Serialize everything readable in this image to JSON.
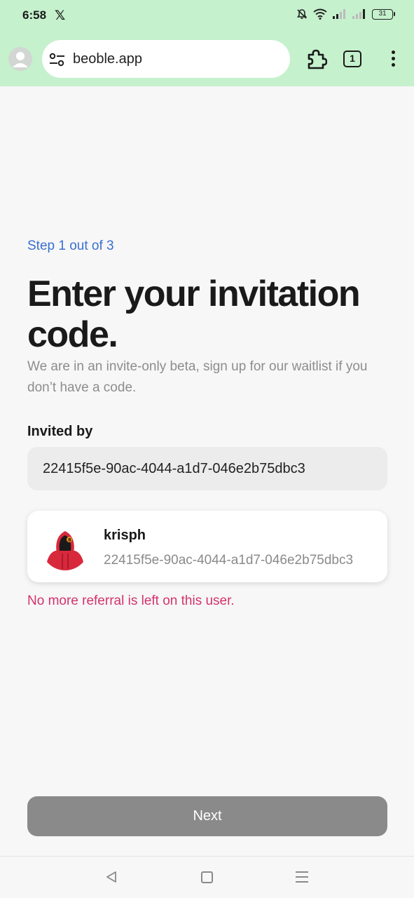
{
  "status_bar": {
    "time": "6:58",
    "battery": "31"
  },
  "browser": {
    "url": "beoble.app",
    "tab_count": "1"
  },
  "page": {
    "step": "Step 1 out of 3",
    "title": "Enter your invitation code.",
    "subtitle": "We are in an invite-only beta, sign up for our waitlist if you don’t have a code.",
    "invited_label": "Invited by",
    "code_value": "22415f5e-90ac-4044-a1d7-046e2b75dbc3",
    "user": {
      "name": "krisph",
      "id": "22415f5e-90ac-4044-a1d7-046e2b75dbc3"
    },
    "error": "No more referral is left on this user.",
    "next_label": "Next"
  },
  "colors": {
    "chrome_bg": "#c5f1cd",
    "step_blue": "#3a6fd0",
    "error_pink": "#d3336d",
    "button_disabled": "#8a8a8a"
  }
}
